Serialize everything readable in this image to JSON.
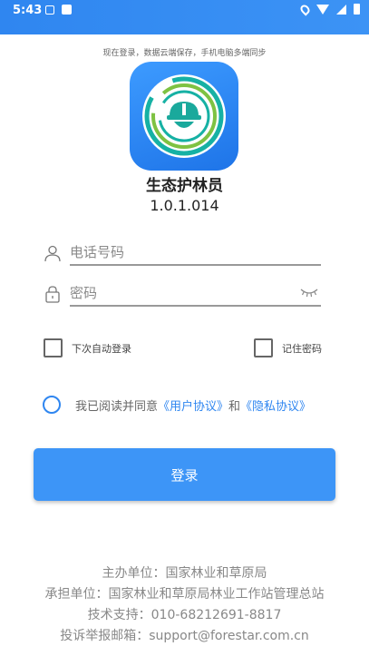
{
  "status_bar": {
    "time": "5:43"
  },
  "header": {
    "sync_tip": "现在登录，数据云端保存，手机电脑多端同步",
    "app_name": "生态护林员",
    "version": "1.0.1.014"
  },
  "form": {
    "phone_placeholder": "电话号码",
    "password_placeholder": "密码",
    "auto_login_label": "下次自动登录",
    "remember_password_label": "记住密码",
    "agree_prefix": "我已阅读并同意",
    "user_agreement": "《用户协议》",
    "agree_and": "和",
    "privacy_agreement": "《隐私协议》",
    "login_label": "登录"
  },
  "footer": {
    "host": "主办单位：国家林业和草原局",
    "undertaker": "承担单位：国家林业和草原局林业工作站管理总站",
    "support": "技术支持：010-68212691-8817",
    "report_email": "投诉举报邮箱：support@forestar.com.cn"
  },
  "colors": {
    "primary": "#3d95f7",
    "status_bar": "#2f86f0"
  },
  "icons": {
    "phone_field": "user-icon",
    "password_field": "lock-icon",
    "password_toggle": "eye-closed-icon"
  }
}
